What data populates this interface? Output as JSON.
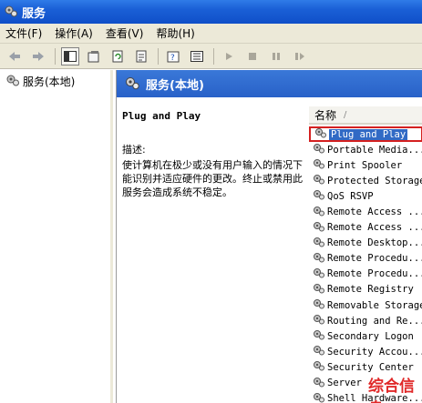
{
  "window": {
    "title": "服务"
  },
  "menu": [
    "文件(F)",
    "操作(A)",
    "查看(V)",
    "帮助(H)"
  ],
  "tree": {
    "root_label": "服务(本地)"
  },
  "pane": {
    "header": "服务(本地)"
  },
  "detail": {
    "service_name": "Plug and Play",
    "desc_label": "描述:",
    "desc_text": "使计算机在极少或没有用户输入的情况下能识别并适应硬件的更改。终止或禁用此服务会造成系统不稳定。"
  },
  "list": {
    "column_name": "名称",
    "sort_indicator": "/",
    "rows": [
      "Plug and Play",
      "Portable Media...",
      "Print Spooler",
      "Protected Storage",
      "QoS RSVP",
      "Remote Access ...",
      "Remote Access ...",
      "Remote Desktop...",
      "Remote Procedu...",
      "Remote Procedu...",
      "Remote Registry",
      "Removable Storage",
      "Routing and Re...",
      "Secondary Logon",
      "Security Accou...",
      "Security Center",
      "Server",
      "Shell Hardware..."
    ],
    "selected_index": 0
  },
  "watermark": {
    "text": "综合信息"
  },
  "colors": {
    "titlebar": "#1a5fd6",
    "selection": "#316ac5",
    "highlight_border": "#d42020"
  },
  "icons": [
    "gear-icon",
    "back-arrow-icon",
    "forward-arrow-icon",
    "console-tree-icon",
    "properties-icon",
    "refresh-icon",
    "export-icon",
    "help-icon",
    "play-icon",
    "stop-icon",
    "pause-icon",
    "restart-icon"
  ]
}
